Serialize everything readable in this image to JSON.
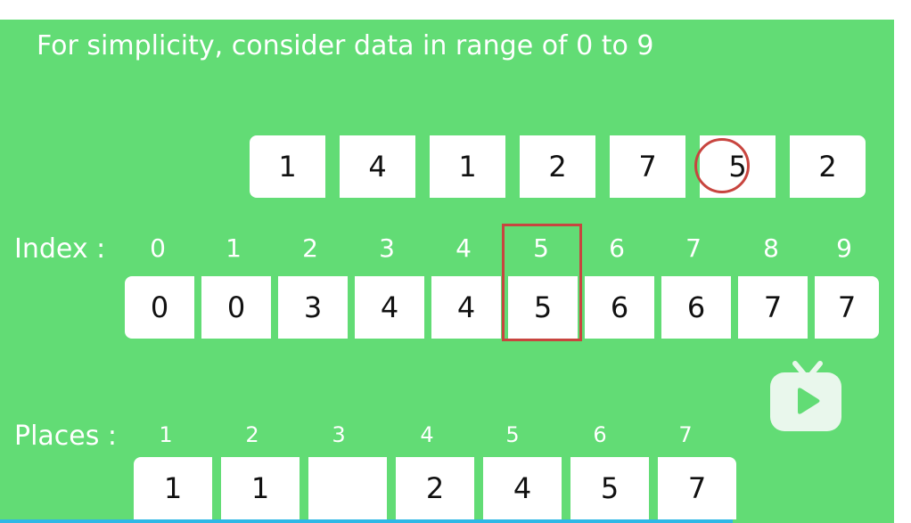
{
  "title": "For simplicity, consider data in range of 0 to 9",
  "input_array": [
    "1",
    "4",
    "1",
    "2",
    "7",
    "5",
    "2"
  ],
  "index_label": "Index :",
  "indices": [
    "0",
    "1",
    "2",
    "3",
    "4",
    "5",
    "6",
    "7",
    "8",
    "9"
  ],
  "count_array": [
    "0",
    "0",
    "3",
    "4",
    "4",
    "5",
    "6",
    "6",
    "7",
    "7"
  ],
  "places_label": "Places :",
  "place_indices": [
    "1",
    "2",
    "3",
    "4",
    "5",
    "6",
    "7"
  ],
  "output_array": [
    "1",
    "1",
    "",
    "2",
    "4",
    "5",
    "7"
  ],
  "highlighted_input_value": "5",
  "highlighted_index": "5",
  "colors": {
    "background": "#62dc75",
    "highlight": "#c8453f",
    "progress_bar": "#2eb8e6"
  },
  "icons": {
    "video_button": "tv-play-icon"
  }
}
